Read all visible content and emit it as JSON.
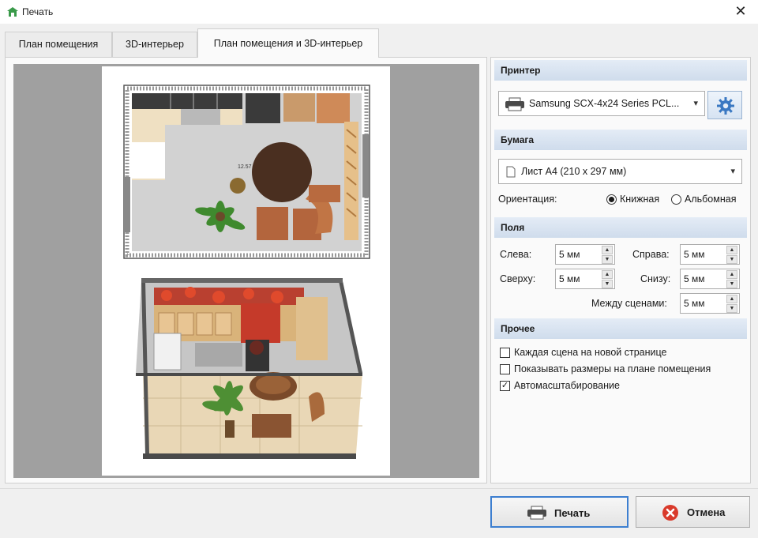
{
  "window": {
    "title": "Печать",
    "close": "✕"
  },
  "tabs": [
    {
      "label": "План помещения"
    },
    {
      "label": "3D-интерьер"
    },
    {
      "label": "План помещения и 3D-интерьер",
      "active": true
    }
  ],
  "plan_annotation": "12.57",
  "printer": {
    "heading": "Принтер",
    "selected": "Samsung SCX-4x24 Series PCL..."
  },
  "paper": {
    "heading": "Бумага",
    "selected": "Лист A4 (210 x 297 мм)",
    "orientation_label": "Ориентация:",
    "orientation_options": [
      "Книжная",
      "Альбомная"
    ],
    "orientation_selected": "Книжная"
  },
  "margins": {
    "heading": "Поля",
    "left_label": "Слева:",
    "left": "5 мм",
    "right_label": "Справа:",
    "right": "5 мм",
    "top_label": "Сверху:",
    "top": "5 мм",
    "bottom_label": "Снизу:",
    "bottom": "5 мм",
    "between_label": "Между сценами:",
    "between": "5 мм"
  },
  "other": {
    "heading": "Прочее",
    "options": [
      {
        "label": "Каждая сцена на новой странице",
        "checked": false
      },
      {
        "label": "Показывать размеры на плане помещения",
        "checked": false
      },
      {
        "label": "Автомасштабирование",
        "checked": true
      }
    ]
  },
  "buttons": {
    "print": "Печать",
    "cancel": "Отмена"
  },
  "colors": {
    "accent": "#3d7fd0",
    "section_header": "#d6e2f0",
    "cancel_icon": "#d93a2b"
  },
  "icons": {
    "settings": "gear-icon",
    "printer": "printer-icon",
    "cancel": "cancel-icon",
    "app": "app-icon"
  }
}
